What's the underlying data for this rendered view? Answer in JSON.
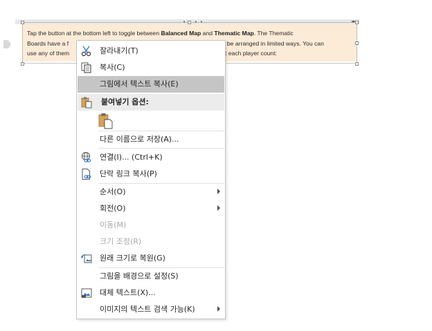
{
  "picture": {
    "segments": [
      {
        "t": "Tap the button at the bottom left to toggle between ",
        "b": false
      },
      {
        "t": "Balanced Map",
        "b": true
      },
      {
        "t": " and ",
        "b": false
      },
      {
        "t": "Thematic Map",
        "b": true
      },
      {
        "t": ". The Thematic Boards have a fi",
        "b": false
      },
      {
        "t": "...",
        "b": false
      },
      {
        "t": " be arranged in limited ways. You can use any of them",
        "b": false
      },
      {
        "t": "...",
        "b": false
      },
      {
        "t": "at each player count:",
        "b": false
      }
    ],
    "line1_a": "Tap the button at the bottom left to toggle between ",
    "line1_b": "Balanced Map",
    "line1_c": " and ",
    "line1_d": "Thematic Map",
    "line1_e": ". The Thematic",
    "line2_a": "Boards have a f",
    "line2_b": "y be arranged in limited ways. You can",
    "line3_a": "use any of them",
    "line3_b": "at each player count:"
  },
  "menu": {
    "cut": "잘라내기(T)",
    "copy": "복사(C)",
    "copy_text_from_picture": "그림에서 텍스트 복사(E)",
    "paste_options_header": "붙여넣기 옵션:",
    "save_as_picture": "다른 이름으로 저장(A)...",
    "link": "연결(I)...  (Ctrl+K)",
    "copy_short_link": "단락 링크 복사(P)",
    "order": "순서(O)",
    "rotate": "회전(O)",
    "move": "이동(M)",
    "resize": "크기 조정(R)",
    "reset_size": "원래 크기로 복원(G)",
    "set_as_background": "그림을 배경으로 설정(S)",
    "alt_text": "대체 텍스트(X)...",
    "searchable_text": "이미지의 텍스트 검색 가능(K)"
  },
  "icons": {
    "cut": "scissors-icon",
    "copy": "copy-icon",
    "paste": "clipboard-icon",
    "link": "globe-link-icon",
    "short_link": "document-link-icon",
    "reset": "reset-picture-icon",
    "alt": "alt-text-icon"
  },
  "colors": {
    "picture_bg": "#fcebd7",
    "hover_bg": "#c5c5c5",
    "section_bg": "#ececec",
    "disabled_text": "#a8a8a8",
    "accent_blue": "#2f6fc7",
    "clipboard_tan": "#d6a158"
  }
}
